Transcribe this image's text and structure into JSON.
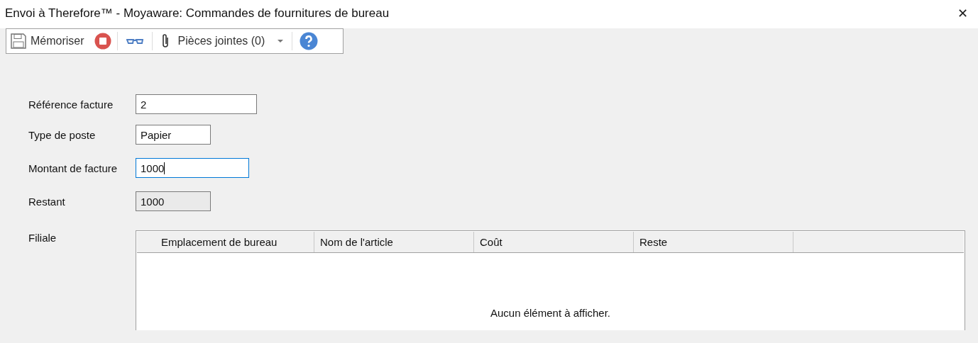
{
  "window": {
    "title": "Envoi à Therefore™ - Moyaware: Commandes de fournitures de bureau",
    "close": "✕"
  },
  "toolbar": [
    {
      "kind": "save",
      "label": "Mémoriser"
    },
    {
      "kind": "stop"
    },
    {
      "kind": "view"
    },
    {
      "kind": "attach",
      "label": "Pièces jointes (0)"
    },
    {
      "kind": "help"
    }
  ],
  "form": [
    {
      "label": "Référence facture",
      "value": "2",
      "focused": false,
      "disabled": false
    },
    {
      "label": "Type de poste",
      "value": "Papier",
      "focused": false,
      "disabled": false
    },
    {
      "label": "Montant de facture",
      "value": "1000",
      "focused": true,
      "disabled": false
    },
    {
      "label": "Restant",
      "value": "1000",
      "focused": false,
      "disabled": true
    }
  ],
  "table": {
    "label": "Filiale",
    "columns": [
      "Emplacement de bureau",
      "Nom de l'article",
      "Coût",
      "Reste"
    ],
    "empty_message": "Aucun élément à afficher."
  }
}
